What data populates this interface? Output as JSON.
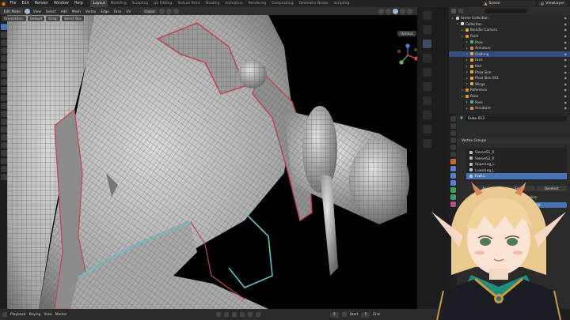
{
  "app": {
    "menus": [
      "File",
      "Edit",
      "Render",
      "Window",
      "Help"
    ],
    "workspaces": [
      "Layout",
      "Modeling",
      "Sculpting",
      "UV Editing",
      "Texture Paint",
      "Shading",
      "Animation",
      "Rendering",
      "Compositing",
      "Geometry Nodes",
      "Scripting"
    ],
    "active_workspace": "Layout",
    "scene_label": "Scene",
    "view_layer_label": "ViewLayer"
  },
  "viewport_header": {
    "mode": "Edit Mode",
    "menus": [
      "View",
      "Select",
      "Add",
      "Mesh",
      "Vertex",
      "Edge",
      "Face",
      "UV"
    ],
    "transform": "Global",
    "options": "Options",
    "sub_orientation": "Orientation:",
    "sub_default": "Default",
    "sub_drag": "Drag:",
    "sub_select_box": "Select Box"
  },
  "outliner": {
    "rows": [
      {
        "label": "Scene Collection",
        "indent": 0,
        "icon": "grp",
        "selected": false
      },
      {
        "label": "Collection",
        "indent": 1,
        "icon": "coll",
        "selected": false
      },
      {
        "label": "Blender Camera",
        "indent": 2,
        "icon": "cam",
        "selected": false
      },
      {
        "label": "Rixie",
        "indent": 2,
        "icon": "arm",
        "selected": false
      },
      {
        "label": "Pose",
        "indent": 3,
        "icon": "pose",
        "selected": false
      },
      {
        "label": "Armature",
        "indent": 3,
        "icon": "arm",
        "selected": false
      },
      {
        "label": "Clothing",
        "indent": 3,
        "icon": "mesh",
        "selected": true
      },
      {
        "label": "Face",
        "indent": 3,
        "icon": "mesh",
        "selected": false
      },
      {
        "label": "Hair",
        "indent": 3,
        "icon": "mesh",
        "selected": false
      },
      {
        "label": "Phae Skin",
        "indent": 3,
        "icon": "mesh",
        "selected": false
      },
      {
        "label": "Phae Skin.001",
        "indent": 3,
        "icon": "mesh",
        "selected": false
      },
      {
        "label": "Wings",
        "indent": 3,
        "icon": "mesh",
        "selected": false
      },
      {
        "label": "Reference",
        "indent": 2,
        "icon": "arm",
        "selected": false
      },
      {
        "label": "Rixie",
        "indent": 2,
        "icon": "arm",
        "selected": false
      },
      {
        "label": "Pose",
        "indent": 3,
        "icon": "pose",
        "selected": false
      },
      {
        "label": "Armature",
        "indent": 3,
        "icon": "arm",
        "selected": false
      }
    ]
  },
  "properties": {
    "object_name": "Cube.013",
    "panel_title": "Vertex Groups",
    "vertex_groups": [
      {
        "label": "SleeveS1_R",
        "selected": false
      },
      {
        "label": "SleeveS2_R",
        "selected": false
      },
      {
        "label": "UpperLeg_L",
        "selected": false
      },
      {
        "label": "LowerLeg_L",
        "selected": false
      },
      {
        "label": "Foot.L",
        "selected": true
      }
    ],
    "buttons": [
      "Assign",
      "Select",
      "Deselect"
    ],
    "normalize": "Normalize",
    "weight_value": "1.000"
  },
  "timeline": {
    "menus": [
      "Playback",
      "Keying",
      "View",
      "Marker"
    ],
    "current_frame": "2",
    "start_label": "Start",
    "start_value": "1",
    "end_label": "End"
  },
  "gizmo_axes": {
    "x": "#e04b4b",
    "y": "#6fbf3a",
    "z": "#4e83e0"
  }
}
